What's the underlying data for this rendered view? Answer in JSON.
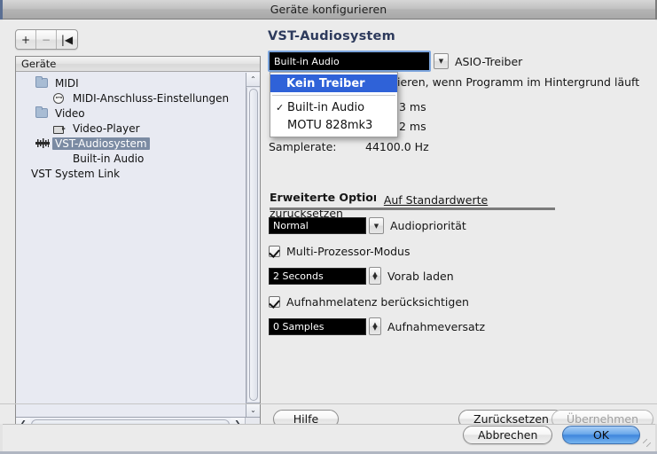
{
  "window": {
    "title": "Geräte konfigurieren"
  },
  "toolbar": {
    "add_label": "+",
    "remove_label": "−",
    "reset_label": "|◀"
  },
  "sidebar": {
    "header": "Geräte",
    "items": [
      {
        "label": "MIDI",
        "icon": "folder-icon",
        "indent": 1,
        "selected": false
      },
      {
        "label": "MIDI-Anschluss-Einstellungen",
        "icon": "midi-port-icon",
        "indent": 2,
        "selected": false
      },
      {
        "label": "Video",
        "icon": "folder-icon",
        "indent": 1,
        "selected": false
      },
      {
        "label": "Video-Player",
        "icon": "camera-icon",
        "indent": 2,
        "selected": false
      },
      {
        "label": "VST-Audiosystem",
        "icon": "audio-device-icon",
        "indent": 1,
        "selected": true
      },
      {
        "label": "Built-in Audio",
        "icon": "none",
        "indent": 2,
        "selected": false
      },
      {
        "label": "VST System Link",
        "icon": "none",
        "indent": 0,
        "selected": false
      }
    ],
    "scroll_up": "⌃",
    "scroll_down": "⌄",
    "scroll_left": "❮",
    "scroll_right": "❯"
  },
  "pane": {
    "title": "VST-Audiosystem",
    "driver": {
      "value": "Built-in Audio",
      "label": "ASIO-Treiber",
      "arrow": "▼"
    },
    "menu": {
      "items": [
        {
          "label": "Kein Treiber",
          "checked": false,
          "highlighted": true
        },
        {
          "label": "Built-in Audio",
          "checked": true,
          "highlighted": false
        },
        {
          "label": "MOTU 828mk3",
          "checked": false,
          "highlighted": false
        }
      ],
      "check_glyph": "✓"
    },
    "background_option_text": "ieren, wenn Programm im Hintergrund läuft",
    "input_latency_value": "3 ms",
    "output_latency_value": "2 ms",
    "samplerate_label": "Samplerate:",
    "samplerate_value": "44100.0 Hz"
  },
  "advanced": {
    "header": "Erweiterte Optionen",
    "reset_link": "Auf Standardwerte zurücksetzen",
    "priority": {
      "value": "Normal",
      "label": "Audiopriorität",
      "arrow": "▼"
    },
    "multiprocessor": {
      "label": "Multi-Prozessor-Modus",
      "checked": true
    },
    "preload": {
      "value": "2 Seconds",
      "label": "Vorab laden",
      "up": "▲",
      "down": "▼"
    },
    "record_latency": {
      "label": "Aufnahmelatenz berücksichtigen",
      "checked": true
    },
    "record_shift": {
      "value": "0 Samples",
      "label": "Aufnahmeversatz",
      "up": "▲",
      "down": "▼"
    }
  },
  "buttons": {
    "help": "Hilfe",
    "reset": "Zurücksetzen",
    "apply": "Übernehmen",
    "cancel": "Abbrechen",
    "ok": "OK"
  },
  "colors": {
    "accent": "#2f62d8",
    "selection": "#7b8ba3",
    "pane_title": "#2d3a5c",
    "ok_button": "#3f86dd"
  }
}
